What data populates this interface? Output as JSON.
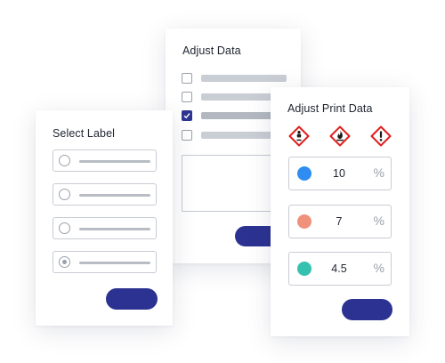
{
  "adjust_data": {
    "title": "Adjust Data",
    "rows": [
      {
        "checked": false
      },
      {
        "checked": false
      },
      {
        "checked": true
      },
      {
        "checked": false
      }
    ]
  },
  "select_label": {
    "title": "Select Label",
    "options": [
      {
        "selected": false
      },
      {
        "selected": false
      },
      {
        "selected": false
      },
      {
        "selected": true
      }
    ]
  },
  "print_data": {
    "title": "Adjust Print Data",
    "hazard_icons": [
      "health-hazard-icon",
      "flammable-icon",
      "exclamation-hazard-icon"
    ],
    "fields": [
      {
        "color": "#2f8cf0",
        "value": "10",
        "unit": "%"
      },
      {
        "color": "#f0917c",
        "value": "7",
        "unit": "%"
      },
      {
        "color": "#35c1b0",
        "value": "4.5",
        "unit": "%"
      }
    ]
  },
  "colors": {
    "accent_button": "#2c3291",
    "checkbox_checked": "#2e3590",
    "hazard_red": "#e01f1f"
  }
}
